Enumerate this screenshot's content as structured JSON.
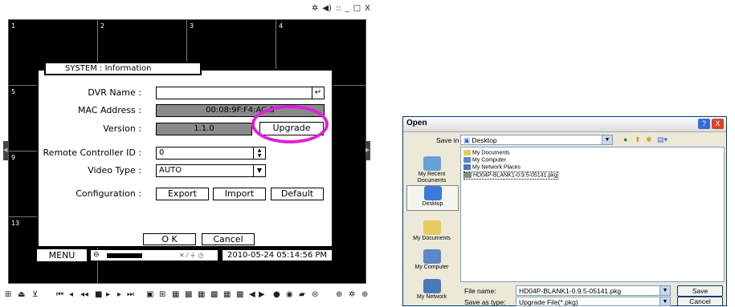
{
  "dvr": {
    "window_controls": [
      "✲",
      "◀)",
      "::",
      "_",
      "□",
      "X"
    ],
    "cells": [
      "1",
      "2",
      "3",
      "4",
      "5",
      "9",
      "13"
    ],
    "dialog": {
      "title": "SYSTEM : Information",
      "dvr_name_label": "DVR Name :",
      "dvr_name_value": "",
      "dvr_name_enter_icon": "↵",
      "mac_label": "MAC Address :",
      "mac_value": "00:08:9F:F4:AC:5",
      "version_label": "Version :",
      "version_value": "1.1.0",
      "upgrade_label": "Upgrade",
      "remote_label": "Remote Controller ID :",
      "remote_value": "0",
      "video_label": "Video Type :",
      "video_value": "AUTO",
      "config_label": "Configuration :",
      "export_label": "Export",
      "import_label": "Import",
      "default_label": "Default",
      "ok_label": "O K",
      "cancel_label": "Cancel"
    },
    "status": {
      "menu_label": "MENU",
      "hdd_fill_percent": 55,
      "datetime": "2010-05-24 05:14:56 PM"
    },
    "toolbar_icons": [
      "playback-icon",
      "eject-icon",
      "search-icon",
      "rewind-icon",
      "prev-icon",
      "play-reverse-icon",
      "stop-icon",
      "play-icon",
      "next-icon",
      "forward-icon",
      "layout-1-icon",
      "layout-4-icon",
      "layout-9-icon",
      "layout-16-icon",
      "arrow-left-icon",
      "arrow-right-icon",
      "record-icon",
      "zoom-icon"
    ]
  },
  "open_dialog": {
    "title": "Open",
    "save_in_label": "Save in :",
    "save_in_value": "Desktop",
    "places": [
      "My Recent Documents",
      "Desktop",
      "My Documents",
      "My Computer",
      "My Network"
    ],
    "files": [
      "My Documents",
      "My Computer",
      "My Network Places",
      "HD04P-BLANK1-0.9.5-05141.pkg"
    ],
    "file_name_label": "File name:",
    "file_name_value": "HD04P-BLANK1-0.9.5-05141.pkg",
    "save_type_label": "Save as type:",
    "save_type_value": "Upgrade File(*.pkg)",
    "save_label": "Save",
    "cancel_label": "Cancel",
    "help_label": "?",
    "close_label": "X"
  }
}
